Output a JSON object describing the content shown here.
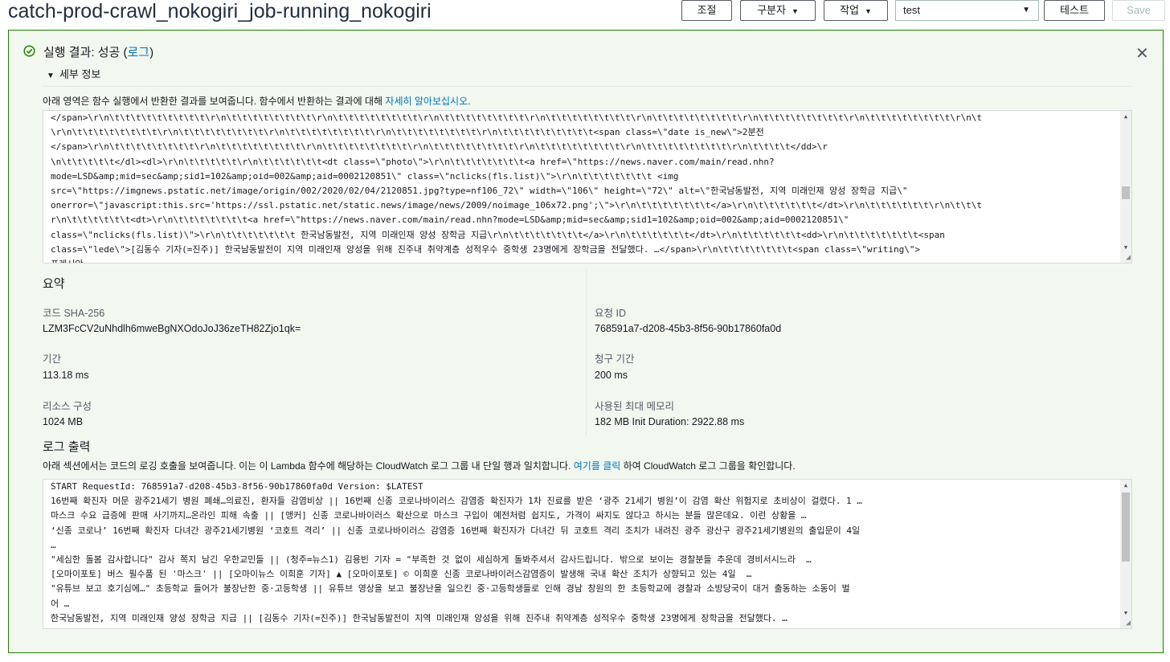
{
  "header": {
    "function_name": "catch-prod-crawl_nokogiri_job-running_nokogiri",
    "throttle_label": "조절",
    "qualifiers_label": "구분자",
    "actions_label": "작업",
    "test_event_selected": "test",
    "test_label": "테스트",
    "save_label": "Save"
  },
  "result": {
    "title_prefix": "실행 결과: 성공 (",
    "title_link": "로그",
    "title_suffix": ")",
    "details_label": "세부 정보",
    "desc_prefix": "아래 영역은 함수 실행에서 반환한 결과를 보여줍니다. 함수에서 반환하는 결과에 대해 ",
    "desc_link": "자세히 알아보십시오",
    "desc_suffix": ".",
    "output_lines": [
      "</span>\\r\\n\\t\\t\\t\\t\\t\\t\\t\\t\\t\\r\\n\\t\\t\\t\\t\\t\\t\\t\\t\\r\\n\\t\\t\\t\\t\\t\\t\\t\\t\\r\\n\\t\\t\\t\\t\\t\\t\\t\\t\\r\\n\\t\\t\\t\\t\\t\\t\\t\\t\\r\\n\\t\\t\\t\\t\\t\\t\\t\\t\\r\\n\\t\\t\\t\\t\\t\\t\\t\\t\\r\\n\\t\\t\\t\\t\\t\\t\\t\\t\\r\\n\\t",
      "\\r\\n\\t\\t\\t\\t\\t\\t\\t\\t\\r\\n\\t\\t\\t\\t\\t\\t\\t\\t\\r\\n\\t\\t\\t\\t\\t\\t\\t\\t\\r\\n\\t\\t\\t\\t\\t\\t\\t\\t\\r\\n\\t\\t\\t\\t\\t\\t\\t\\t\\t<span class=\\\"date is_new\\\">2분전",
      "</span>\\r\\n\\t\\t\\t\\t\\t\\t\\t\\t\\r\\n\\t\\t\\t\\t\\t\\t\\t\\t\\r\\n\\t\\t\\t\\t\\t\\t\\t\\t\\r\\n\\t\\t\\t\\t\\t\\t\\t\\t\\r\\n\\t\\t\\t\\t\\t\\t\\t\\t\\r\\n\\t\\t\\t\\t\\t\\t\\t\\t\\r\\n\\t\\t\\t\\t</dd>\\r",
      "\\n\\t\\t\\t\\t\\t</dl><dl>\\r\\n\\t\\t\\t\\t\\t\\r\\n\\t\\t\\t\\t\\t\\t<dt class=\\\"photo\\\">\\r\\n\\t\\t\\t\\t\\t\\t\\t<a href=\\\"https://news.naver.com/main/read.nhn?",
      "mode=LSD&amp;mid=sec&amp;sid1=102&amp;oid=002&amp;aid=0002120851\\\" class=\\\"nclicks(fls.list)\\\">\\r\\n\\t\\t\\t\\t\\t\\t\\t <img",
      "src=\\\"https://imgnews.pstatic.net/image/origin/002/2020/02/04/2120851.jpg?type=nf106_72\\\" width=\\\"106\\\" height=\\\"72\\\" alt=\\\"한국남동발전, 지역 미래인재 양성 장학금 지급\\\"",
      "onerror=\\\"javascript:this.src='https://ssl.pstatic.net/static.news/image/news/2009/noimage_106x72.png';\\\">\\r\\n\\t\\t\\t\\t\\t\\t\\t</a>\\r\\n\\t\\t\\t\\t\\t\\t</dt>\\r\\n\\t\\t\\t\\t\\t\\t\\r\\n\\t\\t\\t",
      "r\\n\\t\\t\\t\\t\\t\\t<dt>\\r\\n\\t\\t\\t\\t\\t\\t\\t<a href=\\\"https://news.naver.com/main/read.nhn?mode=LSD&amp;mid=sec&amp;sid1=102&amp;oid=002&amp;aid=0002120851\\\"",
      "class=\\\"nclicks(fls.list)\\\">\\r\\n\\t\\t\\t\\t\\t\\t\\t 한국남동발전, 지역 미래인재 양성 장학금 지급\\r\\n\\t\\t\\t\\t\\t\\t\\t</a>\\r\\n\\t\\t\\t\\t\\t\\t</dt>\\r\\n\\t\\t\\t\\t\\t\\t<dd>\\r\\n\\t\\t\\t\\t\\t\\t\\t<span",
      "class=\\\"lede\\\">[김동수 기자(=진주)] 한국남동발전이 지역 미래인재 양성을 위해 진주내 취약계층 성적우수 중학생 23명에게 장학금을 전달했다. …</span>\\r\\n\\t\\t\\t\\t\\t\\t\\t<span class=\\\"writing\\\">",
      "프레시안"
    ]
  },
  "summary": {
    "title": "요약",
    "code_sha_label": "코드 SHA-256",
    "code_sha_value": "LZM3FcCV2uNhdlh6mweBgNXOdoJoJ36zeTH82Zjo1qk=",
    "request_id_label": "요청 ID",
    "request_id_value": "768591a7-d208-45b3-8f56-90b17860fa0d",
    "duration_label": "기간",
    "duration_value": "113.18 ms",
    "billed_label": "청구 기간",
    "billed_value": "200 ms",
    "resources_label": "리소스 구성",
    "resources_value": "1024 MB",
    "max_memory_label": "사용된 최대 메모리",
    "max_memory_value": "182 MB Init Duration: 2922.88 ms"
  },
  "log": {
    "title": "로그 출력",
    "desc_prefix": "아래 섹션에서는 코드의 로깅 호출을 보여줍니다. 이는 이 Lambda 함수에 해당하는 CloudWatch 로그 그룹 내 단일 행과 일치합니다. ",
    "desc_link": "여기를 클릭",
    "desc_suffix": " 하여 CloudWatch 로그 그룹을 확인합니다.",
    "lines": [
      "START RequestId: 768591a7-d208-45b3-8f56-90b17860fa0d Version: $LATEST",
      "16번째 확진자 머문 광주21세기 병원 폐쇄…의료진, 환자들 감염비상 || 16번째 신종 코로나바이러스 감염증 확진자가 1차 진료를 받은 ‘광주 21세기 병원’이 감염 확산 위험지로 초비상이 걸렸다. 1 …",
      "마스크 수요 급증에 판매 사기까지…온라인 피해 속출 || [앵커] 신종 코로나바이러스 확산으로 마스크 구입이 예전처럼 쉽지도, 가격이 싸지도 않다고 하시는 분들 많은데요. 이런 상황을 …",
      "‘신종 코로나’ 16번째 확진자 다녀간 광주21세기병원 ‘코호트 격리’ || 신종 코로나바이러스 감염증 16번째 확진자가 다녀간 뒤 코호트 격리 조치가 내려진 광주 광산구 광주21세기병원의 출입문이 4일",
      "…",
      "\"세심한 돌봄 감사합니다\" 감사 쪽지 남긴 우한교민들 || (청주=뉴스1) 김용빈 기자 = \"부족한 것 없이 세심하게 돌봐주셔서 감사드립니다. 밖으로 보이는 경찰분들 추운데 경비서시느라  …",
      "[오마이포토] 버스 필수품 된 '마스크' || [오마이뉴스 이희훈 기자] ▲ [오마이포토] © 이희훈 신종 코로나바이러스감염증이 발생해 국내 확산 조치가 상향되고 있는 4일  …",
      "\"유튜브 보고 호기심에…\" 초등학교 들어가 불장난한 중·고등학생 || 유튜브 영상을 보고 불장난을 일으킨 중·고등학생들로 인해 경남 창원의 한 초등학교에 경찰과 소방당국이 대거 출동하는 소동이 벌",
      "어 …",
      "한국남동발전, 지역 미래인재 양성 장학금 지급 || [김동수 기자(=진주)] 한국남동발전이 지역 미래인재 양성을 위해 진주내 취약계층 성적우수 중학생 23명에게 장학금을 전달했다. …"
    ]
  }
}
